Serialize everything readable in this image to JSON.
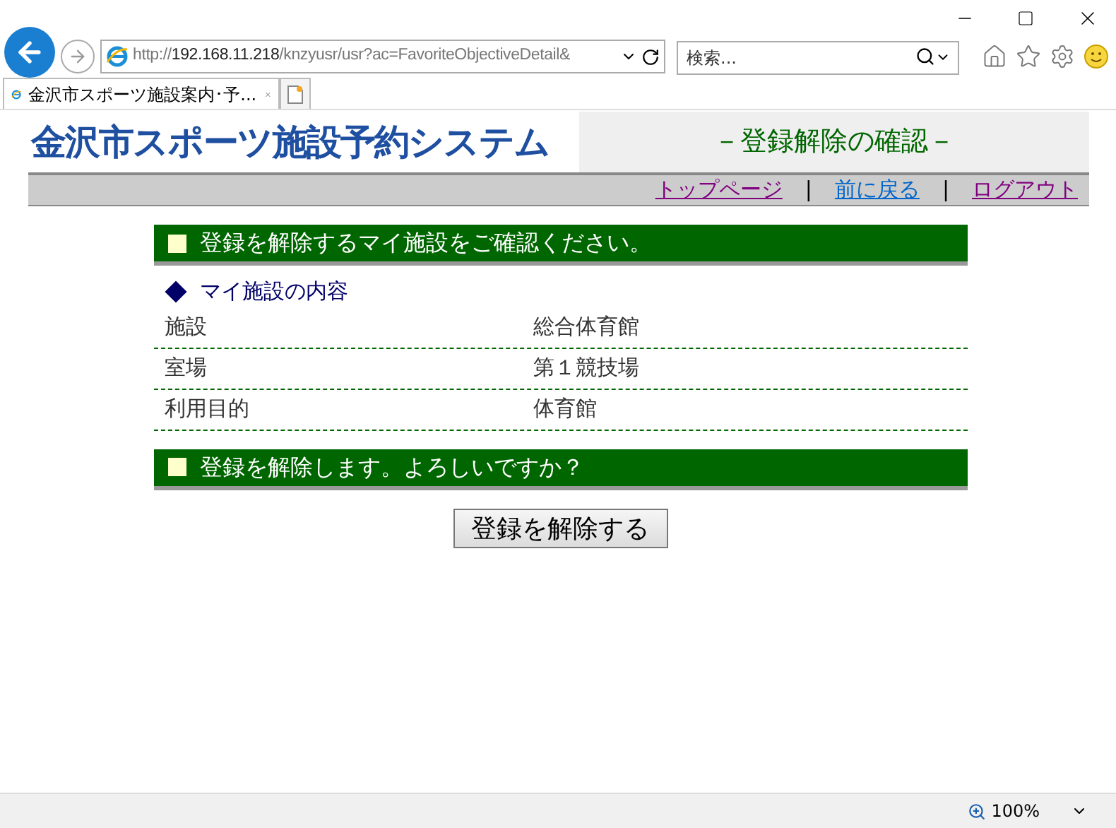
{
  "browser": {
    "url_scheme": "http://",
    "url_host": "192.168.11.218",
    "url_path": "/knzyusr/usr?ac=FavoriteObjectiveDetail&",
    "search": {
      "placeholder": "検索..."
    },
    "tabs": [
      {
        "title": "金沢市スポーツ施設案内･予...",
        "selected": true
      }
    ],
    "zoom": "100%"
  },
  "page": {
    "logo": "金沢市スポーツ施設予約システム",
    "title": "－登録解除の確認－",
    "nav": [
      {
        "kind": "link",
        "label": "トップページ",
        "visited": true
      },
      {
        "kind": "separator",
        "label": "|"
      },
      {
        "kind": "link",
        "label": "前に戻る",
        "visited": false
      },
      {
        "kind": "separator",
        "label": "|"
      },
      {
        "kind": "link",
        "label": "ログアウト",
        "visited": true
      }
    ],
    "heading": "登録を解除するマイ施設をご確認ください。",
    "subheading": "マイ施設の内容",
    "rows": [
      {
        "label": "施設",
        "value": "総合体育館"
      },
      {
        "label": "室場",
        "value": "第１競技場"
      },
      {
        "label": "利用目的",
        "value": "体育館"
      }
    ],
    "confirm": "登録を解除します。よろしいですか？",
    "button": "登録を解除する"
  }
}
